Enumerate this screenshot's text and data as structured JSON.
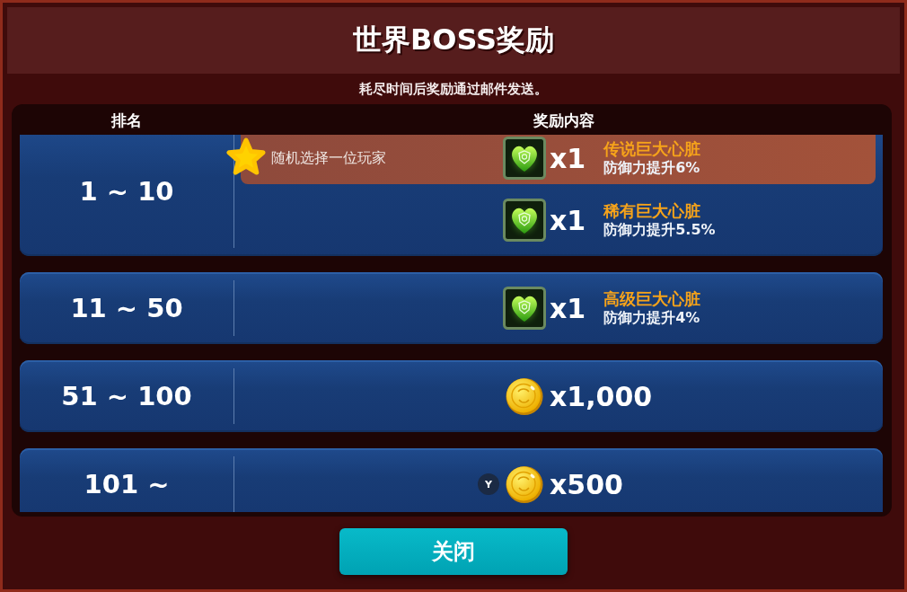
{
  "window": {
    "title": "世界BOSS奖励",
    "subtitle": "耗尽时间后奖励通过邮件发送。"
  },
  "table": {
    "columns": [
      "排名",
      "奖励内容"
    ],
    "rows": [
      {
        "rank": "1 ~ 10",
        "rewards": [
          {
            "kind": "item",
            "featured": true,
            "note": "随机选择一位玩家",
            "quantity": "x1",
            "name": "传说巨大心脏",
            "effect": "防御力提升6%"
          },
          {
            "kind": "item",
            "featured": false,
            "quantity": "x1",
            "name": "稀有巨大心脏",
            "effect": "防御力提升5.5%"
          }
        ]
      },
      {
        "rank": "11 ~ 50",
        "rewards": [
          {
            "kind": "item",
            "featured": false,
            "quantity": "x1",
            "name": "高级巨大心脏",
            "effect": "防御力提升4%"
          }
        ]
      },
      {
        "rank": "51 ~ 100",
        "rewards": [
          {
            "kind": "coin",
            "featured": false,
            "quantity": "x1,000"
          }
        ]
      },
      {
        "rank": "101 ~",
        "rewards": [
          {
            "kind": "coin",
            "featured": false,
            "key_hint": "Y",
            "quantity": "x500"
          }
        ]
      }
    ]
  },
  "buttons": [
    {
      "label": "关闭"
    }
  ]
}
